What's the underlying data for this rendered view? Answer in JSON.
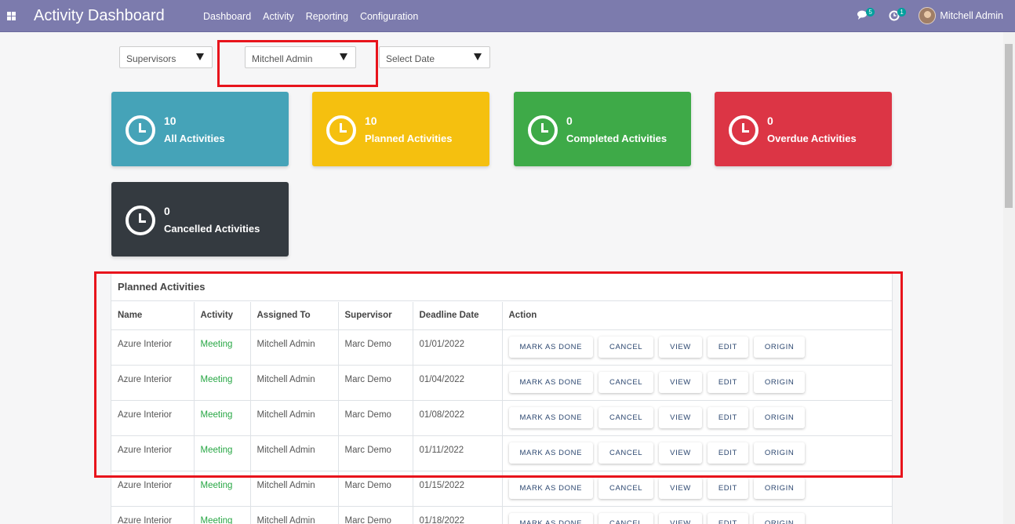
{
  "navbar": {
    "title": "Activity Dashboard",
    "menu": [
      "Dashboard",
      "Activity",
      "Reporting",
      "Configuration"
    ],
    "messages_badge": "5",
    "activities_badge": "1",
    "user_name": "Mitchell Admin"
  },
  "filters": {
    "supervisors": "Supervisors",
    "user": "Mitchell Admin",
    "date": "Select Date"
  },
  "cards": [
    {
      "count": "10",
      "label": "All Activities",
      "color": "#45a3b8"
    },
    {
      "count": "10",
      "label": "Planned Activities",
      "color": "#f5c00f"
    },
    {
      "count": "0",
      "label": "Completed Activities",
      "color": "#3eaa48"
    },
    {
      "count": "0",
      "label": "Overdue Activities",
      "color": "#dc3545"
    },
    {
      "count": "0",
      "label": "Cancelled Activities",
      "color": "#343a40"
    }
  ],
  "table": {
    "title": "Planned Activities",
    "headers": [
      "Name",
      "Activity",
      "Assigned To",
      "Supervisor",
      "Deadline Date",
      "Action"
    ],
    "rows": [
      {
        "name": "Azure Interior",
        "activity": "Meeting",
        "assigned": "Mitchell Admin",
        "supervisor": "Marc Demo",
        "deadline": "01/01/2022"
      },
      {
        "name": "Azure Interior",
        "activity": "Meeting",
        "assigned": "Mitchell Admin",
        "supervisor": "Marc Demo",
        "deadline": "01/04/2022"
      },
      {
        "name": "Azure Interior",
        "activity": "Meeting",
        "assigned": "Mitchell Admin",
        "supervisor": "Marc Demo",
        "deadline": "01/08/2022"
      },
      {
        "name": "Azure Interior",
        "activity": "Meeting",
        "assigned": "Mitchell Admin",
        "supervisor": "Marc Demo",
        "deadline": "01/11/2022"
      },
      {
        "name": "Azure Interior",
        "activity": "Meeting",
        "assigned": "Mitchell Admin",
        "supervisor": "Marc Demo",
        "deadline": "01/15/2022"
      },
      {
        "name": "Azure Interior",
        "activity": "Meeting",
        "assigned": "Mitchell Admin",
        "supervisor": "Marc Demo",
        "deadline": "01/18/2022"
      }
    ],
    "actions": [
      "MARK AS DONE",
      "CANCEL",
      "VIEW",
      "EDIT",
      "ORIGIN"
    ]
  },
  "colors": {
    "navbar": "#7c7bad",
    "highlight": "#e8141c",
    "activity_text": "#28a745"
  }
}
